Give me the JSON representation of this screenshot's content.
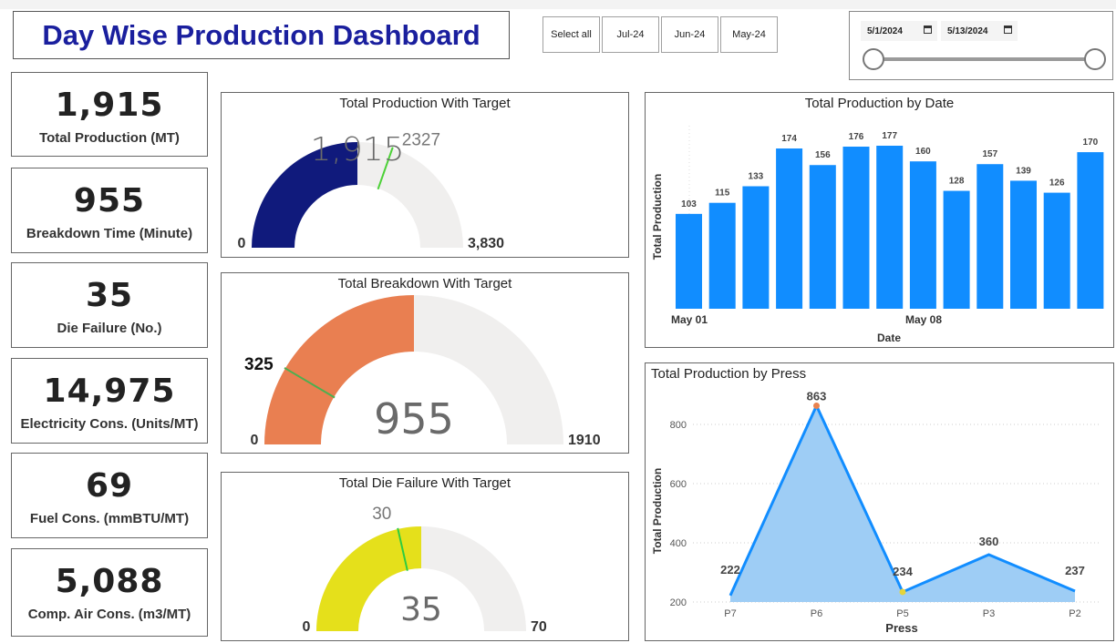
{
  "header": {
    "title": "Day Wise Production Dashboard"
  },
  "month_slicer": {
    "items": [
      "Select all",
      "Jul-24",
      "Jun-24",
      "May-24"
    ]
  },
  "date_slicer": {
    "start": "5/1/2024",
    "end": "5/13/2024",
    "range_fraction": [
      0,
      1
    ]
  },
  "kpis": [
    {
      "value": "1,915",
      "label": "Total Production (MT)"
    },
    {
      "value": "955",
      "label": "Breakdown Time (Minute)"
    },
    {
      "value": "35",
      "label": "Die Failure (No.)"
    },
    {
      "value": "14,975",
      "label": "Electricity Cons. (Units/MT)"
    },
    {
      "value": "69",
      "label": "Fuel Cons. (mmBTU/MT)"
    },
    {
      "value": "5,088",
      "label": "Comp. Air Cons. (m3/MT)"
    }
  ],
  "gauges": [
    {
      "title": "Total Production With Target",
      "value": 1915,
      "value_label": "1,915",
      "min_label": "0",
      "max": 3830,
      "max_label": "3,830",
      "target": 2327,
      "target_label": "2327",
      "fill_color": "#101a7c",
      "target_color": "#4cd137"
    },
    {
      "title": "Total Breakdown With Target",
      "value": 955,
      "value_label": "955",
      "min_label": "0",
      "max": 1910,
      "max_label": "1910",
      "target": 325,
      "target_label": "325",
      "fill_color": "#e97f51",
      "target_color": "#4caf50"
    },
    {
      "title": "Total Die Failure With Target",
      "value": 35,
      "value_label": "35",
      "min_label": "0",
      "max": 70,
      "max_label": "70",
      "target": 30,
      "target_label": "30",
      "fill_color": "#e5e01b",
      "target_color": "#2ecc40"
    }
  ],
  "chart_data": [
    {
      "type": "bar",
      "title": "Total Production by Date",
      "xlabel": "Date",
      "ylabel": "Total Production",
      "x_tick_labels": [
        "May 01",
        "May 08"
      ],
      "categories": [
        "2024-05-01",
        "2024-05-02",
        "2024-05-03",
        "2024-05-04",
        "2024-05-05",
        "2024-05-06",
        "2024-05-07",
        "2024-05-08",
        "2024-05-09",
        "2024-05-10",
        "2024-05-11",
        "2024-05-12",
        "2024-05-13"
      ],
      "values": [
        103,
        115,
        133,
        174,
        156,
        176,
        177,
        160,
        128,
        157,
        139,
        126,
        170
      ],
      "color": "#118dff"
    },
    {
      "type": "area",
      "title": "Total Production by Press",
      "xlabel": "Press",
      "ylabel": "Total Production",
      "categories": [
        "P7",
        "P6",
        "P5",
        "P3",
        "P2"
      ],
      "values": [
        222,
        863,
        234,
        360,
        237
      ],
      "ylim": [
        200,
        880
      ],
      "y_ticks": [
        200,
        400,
        600,
        800
      ],
      "grid": true,
      "color": "#118dff",
      "fill_color": "#9ecdf5"
    }
  ]
}
